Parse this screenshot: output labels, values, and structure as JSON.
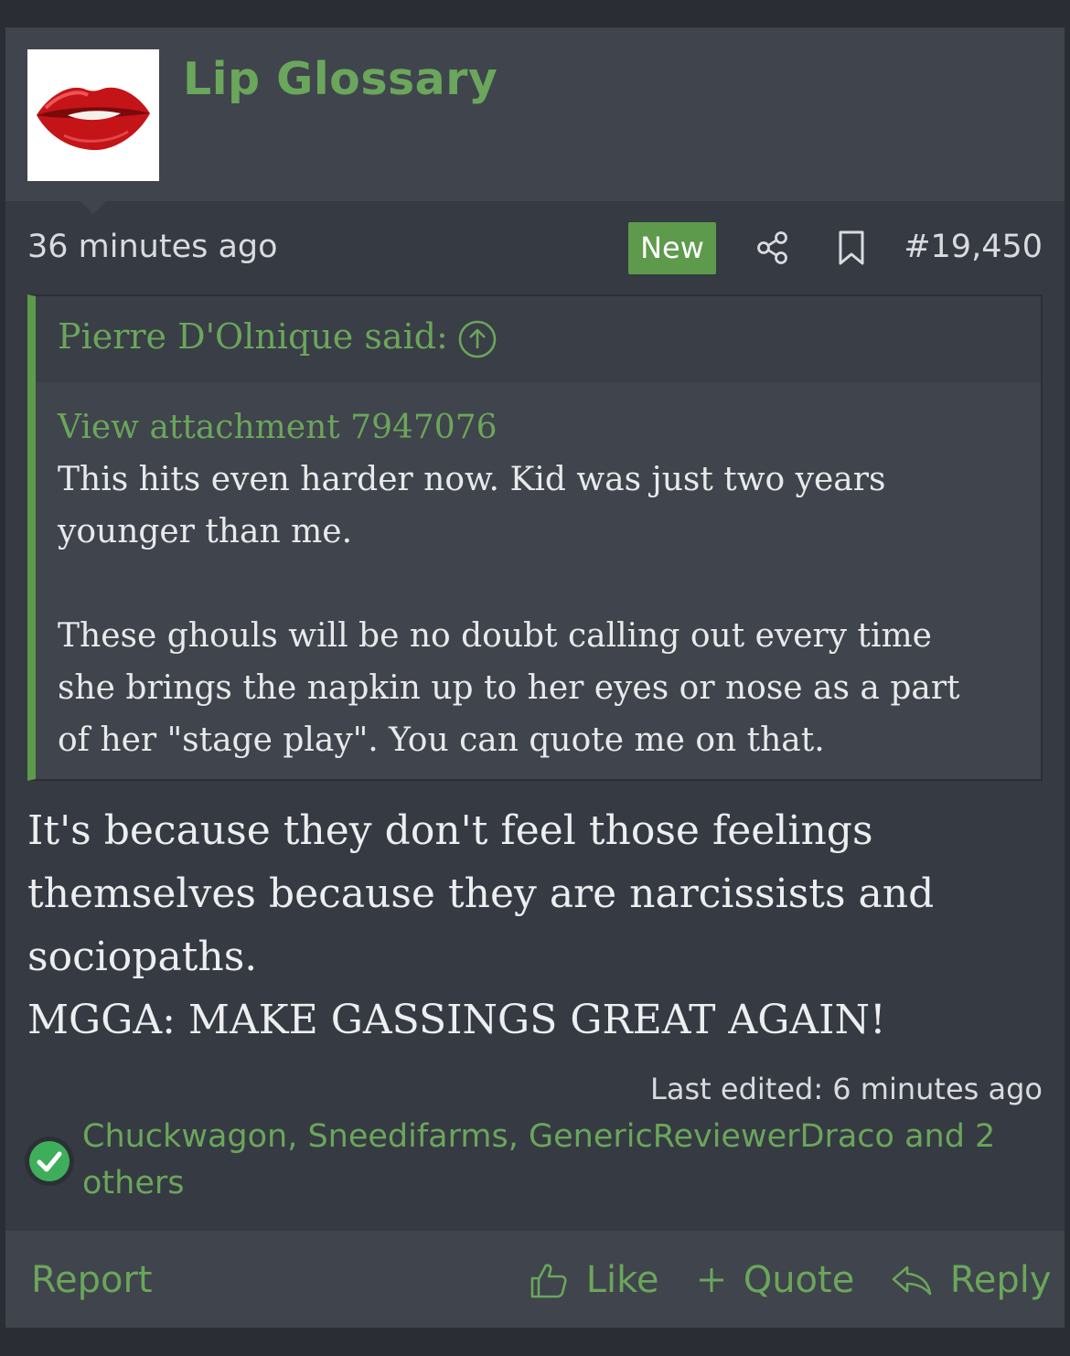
{
  "user": {
    "name": "Lip Glossary",
    "avatar_icon": "lips-avatar"
  },
  "post": {
    "time": "36 minutes ago",
    "badge": "New",
    "number": "#19,450",
    "share_icon": "share-icon",
    "bookmark_icon": "bookmark-icon"
  },
  "quote": {
    "author": "Pierre D'Olnique said:",
    "attachment_link": "View attachment 7947076",
    "paragraph1": [
      "This hits even harder now. Kid was just two years",
      "younger than me."
    ],
    "paragraph2": [
      "These ghouls will be no doubt calling out every time",
      "she brings the napkin up to her eyes or nose as a part",
      "of her \"stage play\". You can quote me on that."
    ]
  },
  "message": {
    "lines": [
      "It's because they don't feel those feelings",
      "themselves because they are narcissists and",
      "sociopaths.",
      "MGGA: MAKE GASSINGS GREAT AGAIN!"
    ]
  },
  "last_edited": "Last edited: 6 minutes ago",
  "reactions": {
    "icon": "checkmark-reaction-icon",
    "users_lines": [
      "Chuckwagon, Sneedifarms, GenericReviewerDraco and 2",
      "others"
    ]
  },
  "footer": {
    "report": "Report",
    "like": "Like",
    "quote": "Quote",
    "reply": "Reply"
  },
  "colors": {
    "accent_green": "#6aa65b",
    "badge_green": "#5e9a4b",
    "post_bg": "#363a42",
    "header_bg": "#40444c"
  }
}
